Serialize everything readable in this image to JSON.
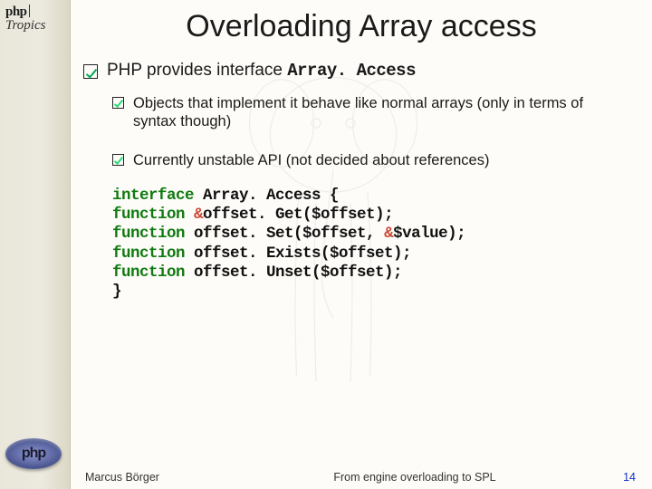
{
  "branding": {
    "top_word": "php",
    "top_sub": "Tropics",
    "logo_text": "php"
  },
  "slide": {
    "title": "Overloading Array access",
    "lead_pre": "PHP provides interface ",
    "lead_mono": "Array. Access",
    "bullets": [
      "Objects that implement it behave like normal arrays (only in terms of syntax though)",
      "Currently unstable API (not decided about references)"
    ]
  },
  "code": {
    "l1_kw": "interface",
    "l1_rest": " Array. Access {",
    "l2_kw": " function",
    "l2_amp": " &",
    "l2_rest": "offset. Get($offset);",
    "l3_kw": " function",
    "l3_a": " offset. Set($offset, ",
    "l3_amp": "&",
    "l3_b": "$value);",
    "l4_kw": " function",
    "l4_rest": " offset. Exists($offset);",
    "l5_kw": " function",
    "l5_rest": " offset. Unset($offset);",
    "l6": "}"
  },
  "footer": {
    "author": "Marcus Börger",
    "talk": "From engine overloading to SPL",
    "page": "14"
  }
}
